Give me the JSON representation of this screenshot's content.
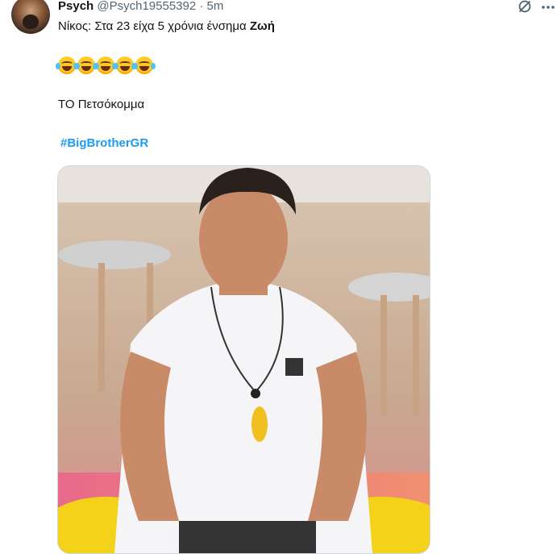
{
  "author": {
    "name": "Psych",
    "handle": "@Psych19555392",
    "separator": "·",
    "time": "5m"
  },
  "tweet": {
    "line1_prefix": "Νίκος: Στα 23 είχα 5 χρόνια ένσημα ",
    "line1_bold": "Ζωή",
    "emoji_count": 5,
    "emoji": "face-with-tears-of-joy",
    "line2": "ΤΟ Πετσόκομμα",
    "hashtag": "#BigBrotherGR"
  },
  "icons": {
    "grok": "grok-icon",
    "more": "more-options-icon"
  },
  "colors": {
    "link": "#1d9bf0",
    "secondary_text": "#536471",
    "primary_text": "#0f1419"
  }
}
